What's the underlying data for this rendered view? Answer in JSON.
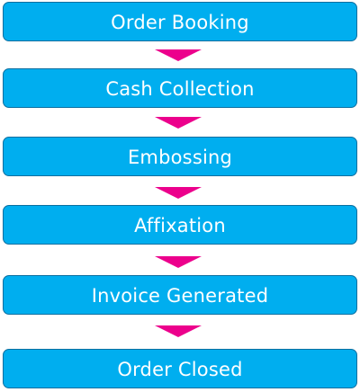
{
  "diagram": {
    "type": "vertical-flow",
    "colors": {
      "box_fill": "#00aeef",
      "box_border": "#0b6fa0",
      "box_text": "#ffffff",
      "arrow": "#ec008c"
    },
    "steps": [
      {
        "label": "Order Booking"
      },
      {
        "label": "Cash Collection"
      },
      {
        "label": "Embossing"
      },
      {
        "label": "Affixation"
      },
      {
        "label": "Invoice Generated"
      },
      {
        "label": "Order Closed"
      }
    ],
    "arrows": [
      {
        "from": "Order Booking",
        "to": "Cash Collection"
      },
      {
        "from": "Cash Collection",
        "to": "Embossing"
      },
      {
        "from": "Embossing",
        "to": "Affixation"
      },
      {
        "from": "Affixation",
        "to": "Invoice Generated"
      },
      {
        "from": "Invoice Generated",
        "to": "Order Closed"
      }
    ]
  }
}
